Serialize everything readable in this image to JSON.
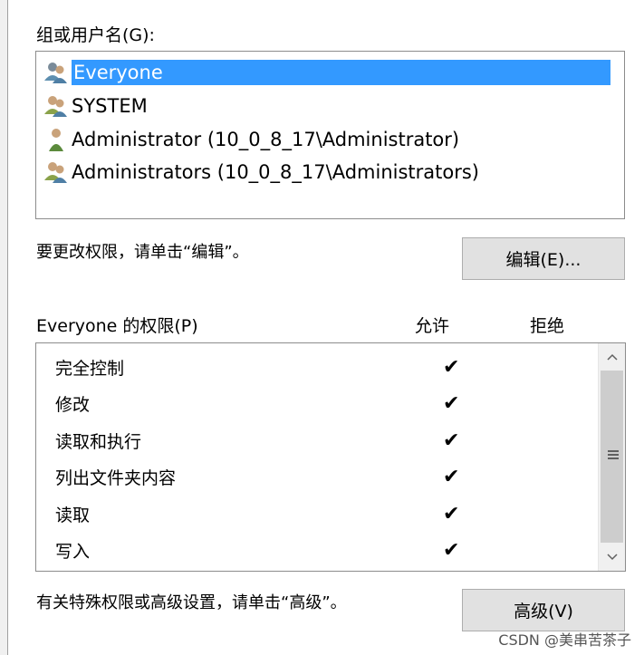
{
  "group_label": "组或用户名(G):",
  "users": [
    {
      "name": "Everyone",
      "icon": "users-icon",
      "selected": true
    },
    {
      "name": "SYSTEM",
      "icon": "users-icon",
      "selected": false
    },
    {
      "name": "Administrator (10_0_8_17\\Administrator)",
      "icon": "user-icon",
      "selected": false
    },
    {
      "name": "Administrators (10_0_8_17\\Administrators)",
      "icon": "users-icon",
      "selected": false
    }
  ],
  "change_hint": "要更改权限，请单击“编辑”。",
  "edit_button": "编辑(E)...",
  "permissions_title": "Everyone 的权限(P)",
  "col_allow": "允许",
  "col_deny": "拒绝",
  "permissions": [
    {
      "name": "完全控制",
      "allow": "✔",
      "deny": ""
    },
    {
      "name": "修改",
      "allow": "✔",
      "deny": ""
    },
    {
      "name": "读取和执行",
      "allow": "✔",
      "deny": ""
    },
    {
      "name": "列出文件夹内容",
      "allow": "✔",
      "deny": ""
    },
    {
      "name": "读取",
      "allow": "✔",
      "deny": ""
    },
    {
      "name": "写入",
      "allow": "✔",
      "deny": ""
    }
  ],
  "advanced_hint": "有关特殊权限或高级设置，请单击“高级”。",
  "advanced_button": "高级(V)",
  "watermark": "CSDN @美串苦茶子",
  "colors": {
    "selection": "#3399ff",
    "button": "#e1e1e1"
  }
}
